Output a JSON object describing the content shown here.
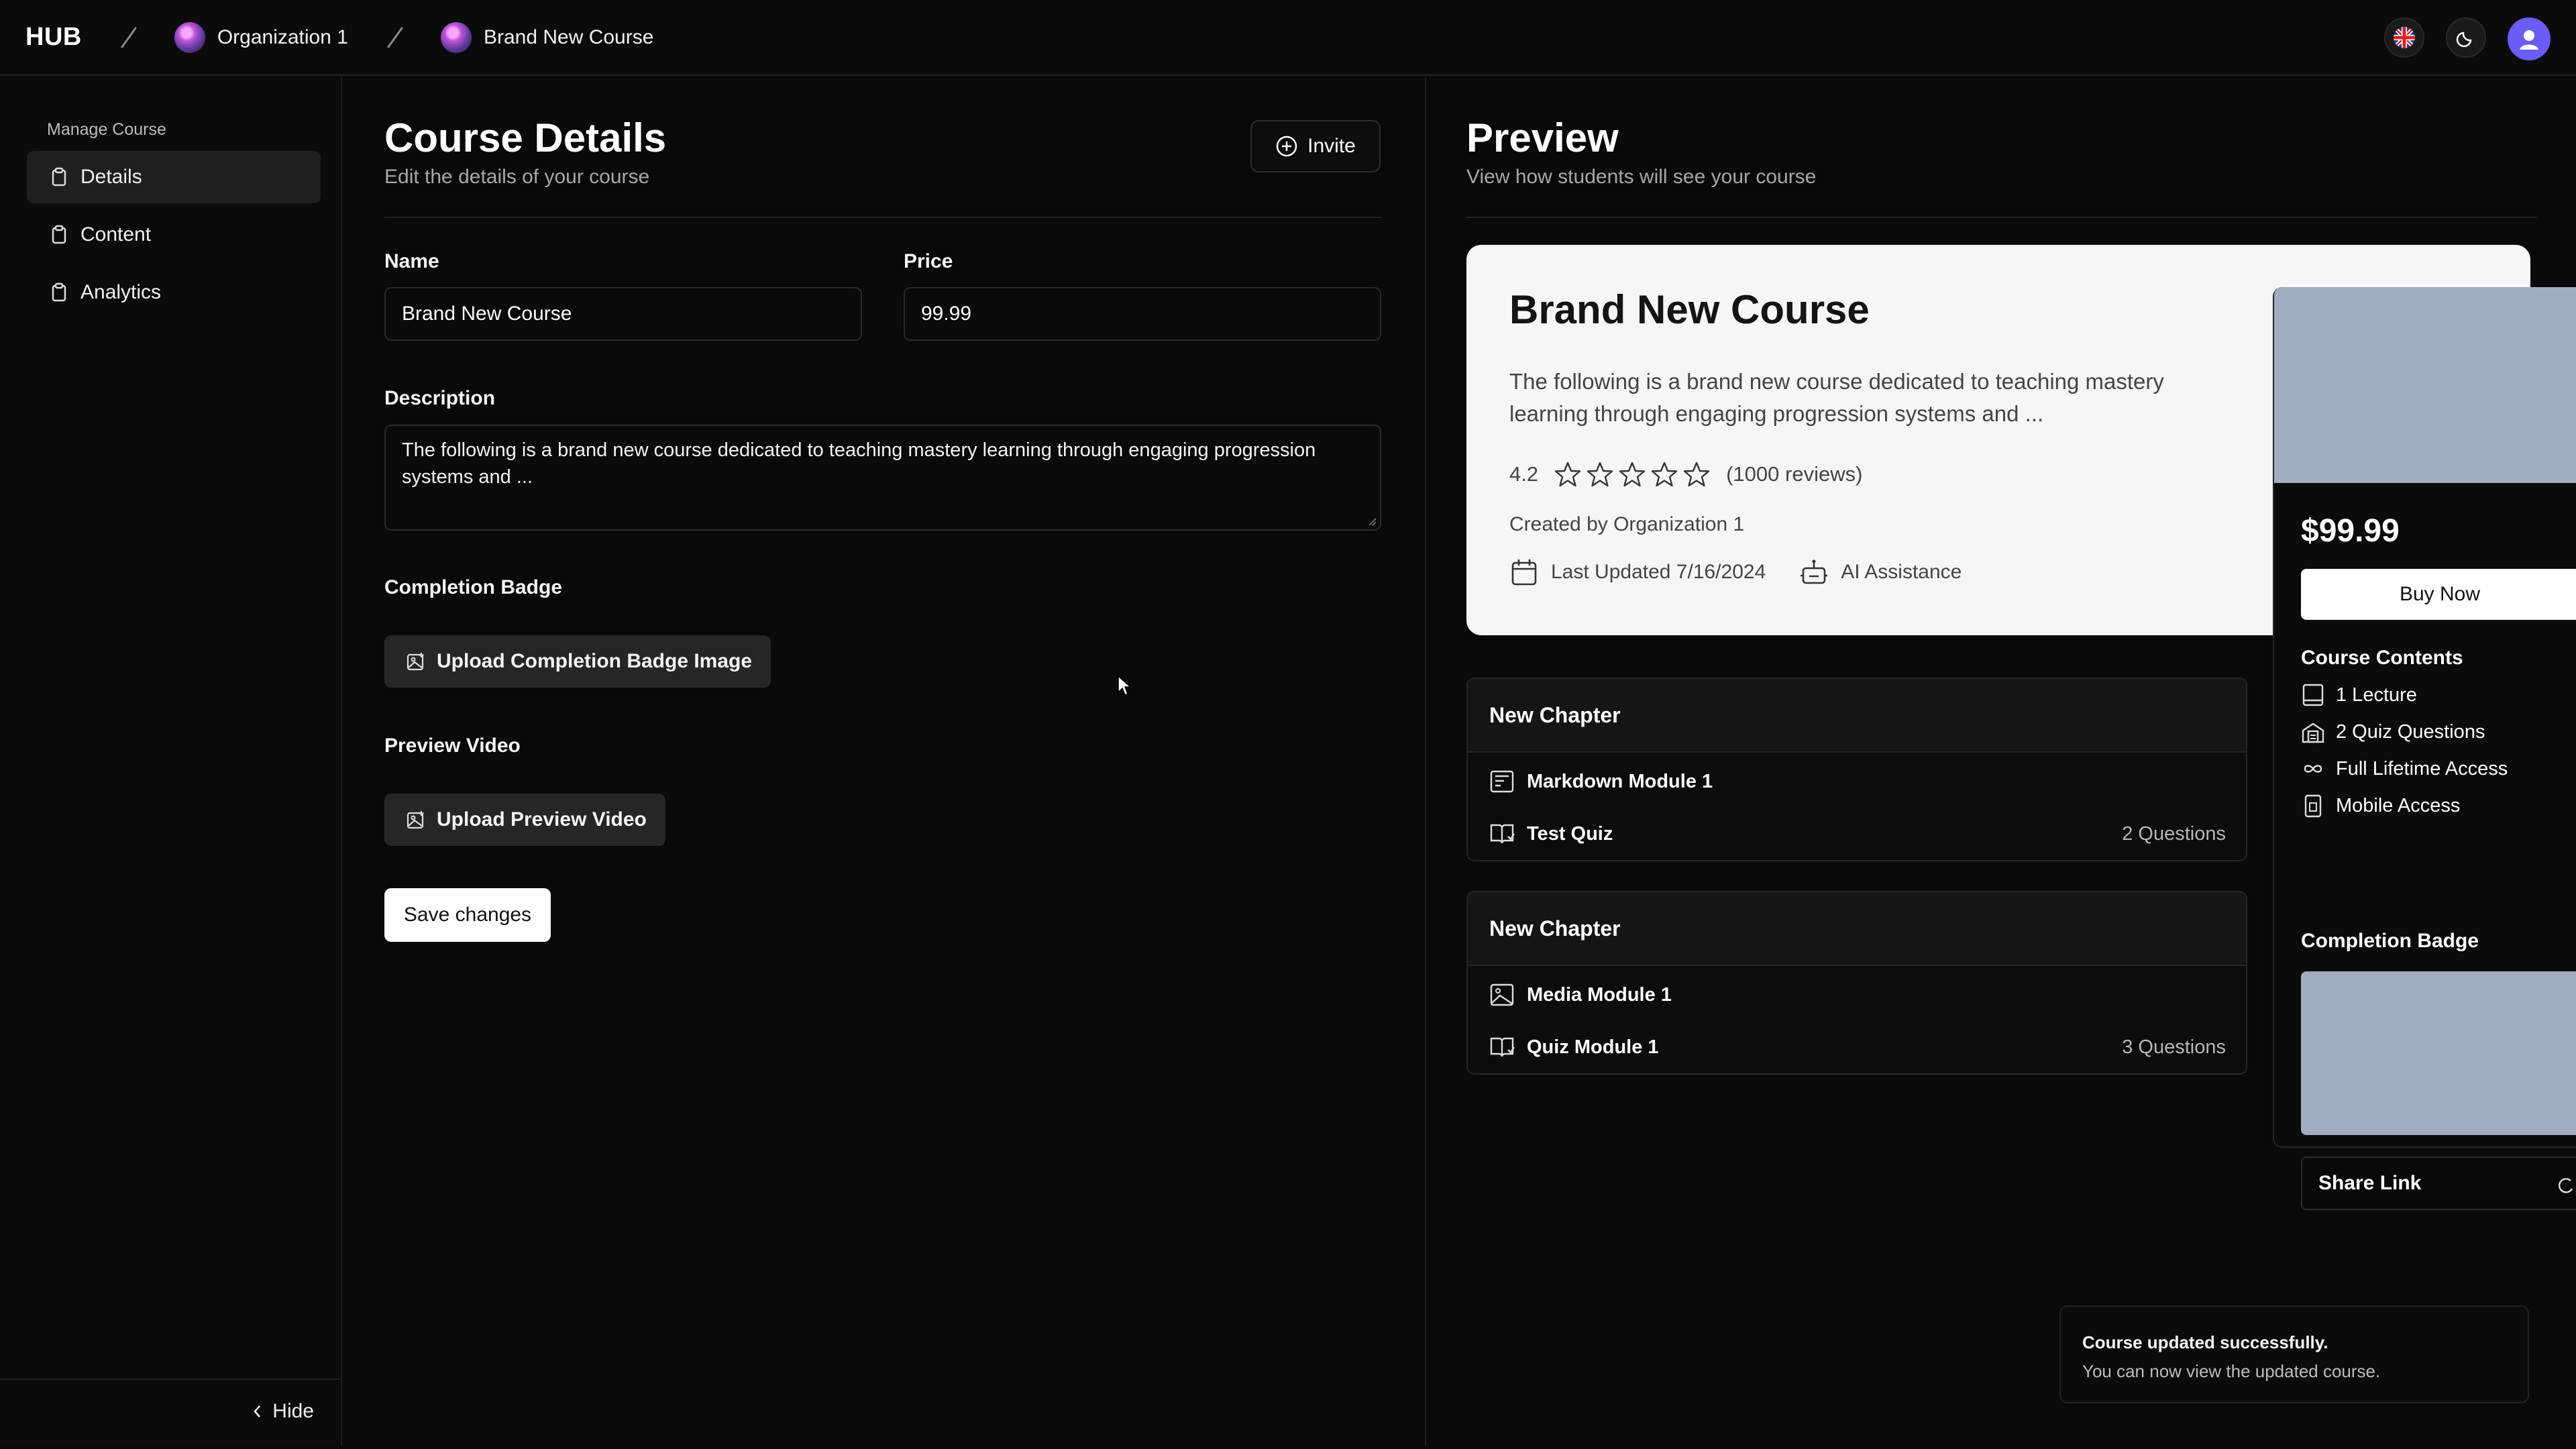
{
  "topbar": {
    "brand": "HUB",
    "breadcrumbs": [
      {
        "label": "Organization 1"
      },
      {
        "label": "Brand New Course"
      }
    ],
    "icons": [
      "flag-uk-icon",
      "moon-icon",
      "user-avatar-icon"
    ]
  },
  "sidebar": {
    "title": "Manage Course",
    "items": [
      {
        "label": "Details",
        "active": true
      },
      {
        "label": "Content",
        "active": false
      },
      {
        "label": "Analytics",
        "active": false
      }
    ],
    "hide_label": "Hide"
  },
  "details": {
    "title": "Course Details",
    "subtitle": "Edit the details of your course",
    "invite_label": "Invite",
    "name_label": "Name",
    "name_value": "Brand New Course",
    "price_label": "Price",
    "price_value": "99.99",
    "description_label": "Description",
    "description_value": "The following is a brand new course dedicated to teaching mastery learning through engaging progression systems and ...",
    "badge_label": "Completion Badge",
    "badge_upload_label": "Upload Completion Badge Image",
    "video_label": "Preview Video",
    "video_upload_label": "Upload Preview Video",
    "save_label": "Save changes"
  },
  "preview": {
    "title": "Preview",
    "subtitle": "View how students will see your course",
    "course_title": "Brand New Course",
    "course_desc": "The following is a brand new course dedicated to teaching mastery learning through engaging progression systems and ...",
    "rating": "4.2",
    "rating_stars": 5,
    "reviews": "(1000 reviews)",
    "created_by": "Created by Organization 1",
    "last_updated": "Last Updated 7/16/2024",
    "ai": "AI Assistance",
    "chapters": [
      {
        "title": "New Chapter",
        "modules": [
          {
            "icon": "markdown-icon",
            "name": "Markdown Module 1",
            "questions": ""
          },
          {
            "icon": "quiz-book-icon",
            "name": "Test Quiz",
            "questions": "2 Questions"
          }
        ]
      },
      {
        "title": "New Chapter",
        "modules": [
          {
            "icon": "image-icon",
            "name": "Media Module 1",
            "questions": ""
          },
          {
            "icon": "quiz-book-icon",
            "name": "Quiz Module 1",
            "questions": "3 Questions"
          }
        ]
      }
    ],
    "price": "$99.99",
    "buy_label": "Buy Now",
    "contents_title": "Course Contents",
    "contents": [
      {
        "icon": "lecture-icon",
        "label": "1 Lecture"
      },
      {
        "icon": "quiz-icon",
        "label": "2 Quiz Questions"
      },
      {
        "icon": "infinity-icon",
        "label": "Full Lifetime Access"
      },
      {
        "icon": "mobile-icon",
        "label": "Mobile Access"
      }
    ],
    "badge_title": "Completion Badge",
    "share_label": "Share Link"
  },
  "toast": {
    "title": "Course updated successfully.",
    "body": "You can now view the updated course."
  },
  "colors": {
    "background": "#090909",
    "card": "#f6f6f6",
    "placeholder_image": "#a0acc0",
    "avatar": "#6b5cf5"
  }
}
